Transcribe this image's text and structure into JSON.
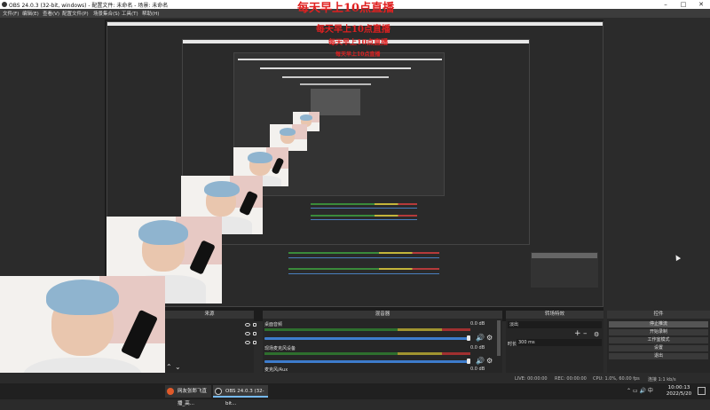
{
  "window": {
    "title": "OBS 24.0.3 (32-bit, windows) - 配置文件: 未命名 - 场景: 未命名",
    "minimize": "–",
    "maximize": "□",
    "close": "✕"
  },
  "menu": [
    "文件(F)",
    "编辑(E)",
    "查看(V)",
    "配置文件(P)",
    "场景集合(S)",
    "工具(T)",
    "帮助(H)"
  ],
  "banner": "每天早上10点直播",
  "banner_nested": [
    "每天早上10点直播",
    "每天早上10点直播",
    "每天早上10点直播"
  ],
  "docks": {
    "sources": "来源",
    "mixer": "混音器",
    "transitions": "转场特效",
    "controls": "控件"
  },
  "mixer": {
    "channels": [
      {
        "name": "桌面音频",
        "db": "0.0 dB"
      },
      {
        "name": "现场麦克风设备",
        "db": "0.0 dB"
      },
      {
        "name": "麦克风/Aux",
        "db": "0.0 dB"
      }
    ]
  },
  "transitions": {
    "selected": "淡出",
    "add": "+",
    "remove": "–",
    "duration_label": "时长",
    "duration_value": "300 ms"
  },
  "controls": {
    "buttons": [
      "停止推流",
      "开始录制",
      "工作室模式",
      "设置",
      "退出"
    ]
  },
  "status": {
    "live": "LIVE: 00:00:00",
    "rec": "REC: 00:00:00",
    "cpu": "CPU: 1.0%, 60.00 fps",
    "streaming": "连接 1:1 kb/s"
  },
  "taskbar": {
    "items": [
      "网友张郎飞直播_高...",
      "OBS 24.0.3 (32-bit..."
    ],
    "time": "10:00:13",
    "date": "2022/5/20"
  },
  "colors": {
    "banner_red": "#e02020",
    "accent_blue": "#3d7ccc",
    "obs_dark": "#2b2b2b"
  }
}
